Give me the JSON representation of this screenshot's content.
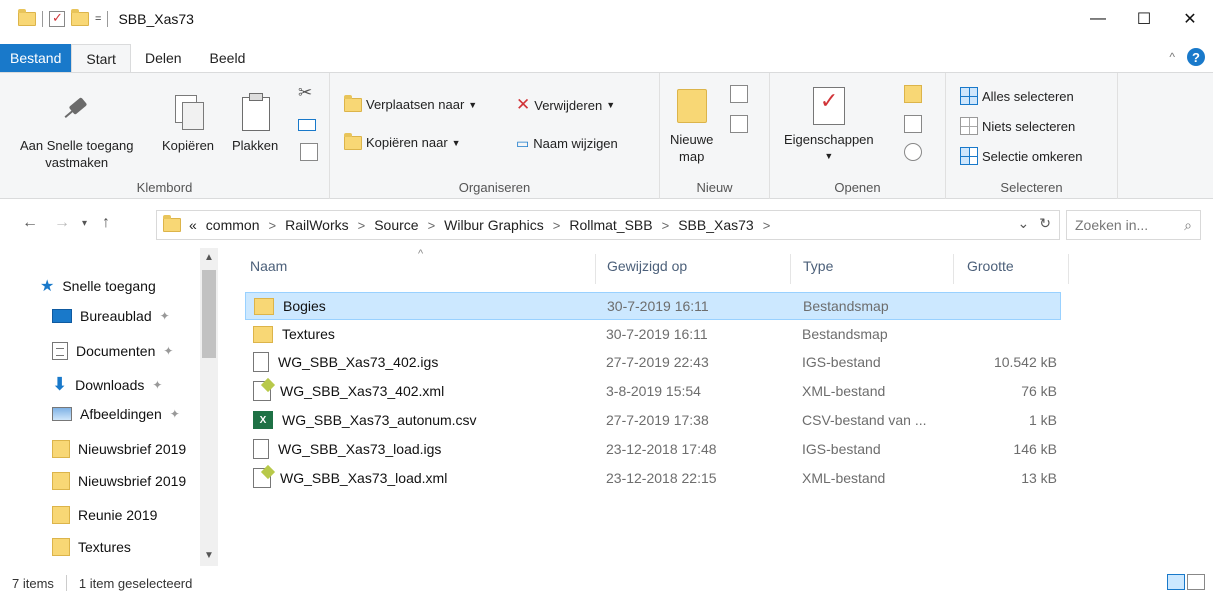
{
  "window": {
    "title": "SBB_Xas73",
    "qat_dropdown": "="
  },
  "window_controls": {
    "minimize": "—",
    "maximize": "☐",
    "close": "✕"
  },
  "ribbon_tabs": [
    {
      "label": "Bestand"
    },
    {
      "label": "Start"
    },
    {
      "label": "Delen"
    },
    {
      "label": "Beeld"
    }
  ],
  "ribbon": {
    "klembord": {
      "label": "Klembord",
      "pin_line1": "Aan Snelle toegang",
      "pin_line2": "vastmaken",
      "copy": "Kopiëren",
      "paste": "Plakken"
    },
    "organiseren": {
      "label": "Organiseren",
      "move": "Verplaatsen naar",
      "copy_to": "Kopiëren naar",
      "delete": "Verwijderen",
      "rename": "Naam wijzigen"
    },
    "nieuw": {
      "label": "Nieuw",
      "new_folder_line1": "Nieuwe",
      "new_folder_line2": "map"
    },
    "openen": {
      "label": "Openen",
      "properties": "Eigenschappen"
    },
    "selecteren": {
      "label": "Selecteren",
      "select_all": "Alles selecteren",
      "select_none": "Niets selecteren",
      "invert": "Selectie omkeren"
    }
  },
  "address": {
    "crumbs": [
      "«",
      "common",
      "RailWorks",
      "Source",
      "Wilbur Graphics",
      "Rollmat_SBB",
      "SBB_Xas73"
    ],
    "search_placeholder": "Zoeken in..."
  },
  "nav_pane": {
    "quick_access": "Snelle toegang",
    "items": [
      {
        "label": "Bureaublad",
        "icon": "desktop-icon"
      },
      {
        "label": "Documenten",
        "icon": "documents-icon"
      },
      {
        "label": "Downloads",
        "icon": "download-icon"
      },
      {
        "label": "Afbeeldingen",
        "icon": "pictures-icon"
      },
      {
        "label": "Nieuwsbrief 2019",
        "icon": "folder-icon"
      },
      {
        "label": "Nieuwsbrief 2019",
        "icon": "folder-icon"
      },
      {
        "label": "Reunie 2019",
        "icon": "folder-icon"
      },
      {
        "label": "Textures",
        "icon": "folder-icon"
      }
    ]
  },
  "columns": {
    "name": "Naam",
    "modified": "Gewijzigd op",
    "type": "Type",
    "size": "Grootte"
  },
  "files": [
    {
      "name": "Bogies",
      "modified": "30-7-2019 16:11",
      "type": "Bestandsmap",
      "size": "",
      "icon": "folder-icon",
      "selected": true
    },
    {
      "name": "Textures",
      "modified": "30-7-2019 16:11",
      "type": "Bestandsmap",
      "size": "",
      "icon": "folder-icon"
    },
    {
      "name": "WG_SBB_Xas73_402.igs",
      "modified": "27-7-2019 22:43",
      "type": "IGS-bestand",
      "size": "10.542 kB",
      "icon": "file-icon"
    },
    {
      "name": "WG_SBB_Xas73_402.xml",
      "modified": "3-8-2019 15:54",
      "type": "XML-bestand",
      "size": "76 kB",
      "icon": "xml-icon"
    },
    {
      "name": "WG_SBB_Xas73_autonum.csv",
      "modified": "27-7-2019 17:38",
      "type": "CSV-bestand van ...",
      "size": "1 kB",
      "icon": "csv-icon"
    },
    {
      "name": "WG_SBB_Xas73_load.igs",
      "modified": "23-12-2018 17:48",
      "type": "IGS-bestand",
      "size": "146 kB",
      "icon": "file-icon"
    },
    {
      "name": "WG_SBB_Xas73_load.xml",
      "modified": "23-12-2018 22:15",
      "type": "XML-bestand",
      "size": "13 kB",
      "icon": "xml-icon"
    }
  ],
  "status": {
    "count": "7 items",
    "selected": "1 item geselecteerd"
  },
  "colors": {
    "accent": "#1979ca",
    "selection": "#cce8ff",
    "selection_border": "#99d1ff",
    "folder": "#f8d775",
    "delete_red": "#d13438"
  }
}
